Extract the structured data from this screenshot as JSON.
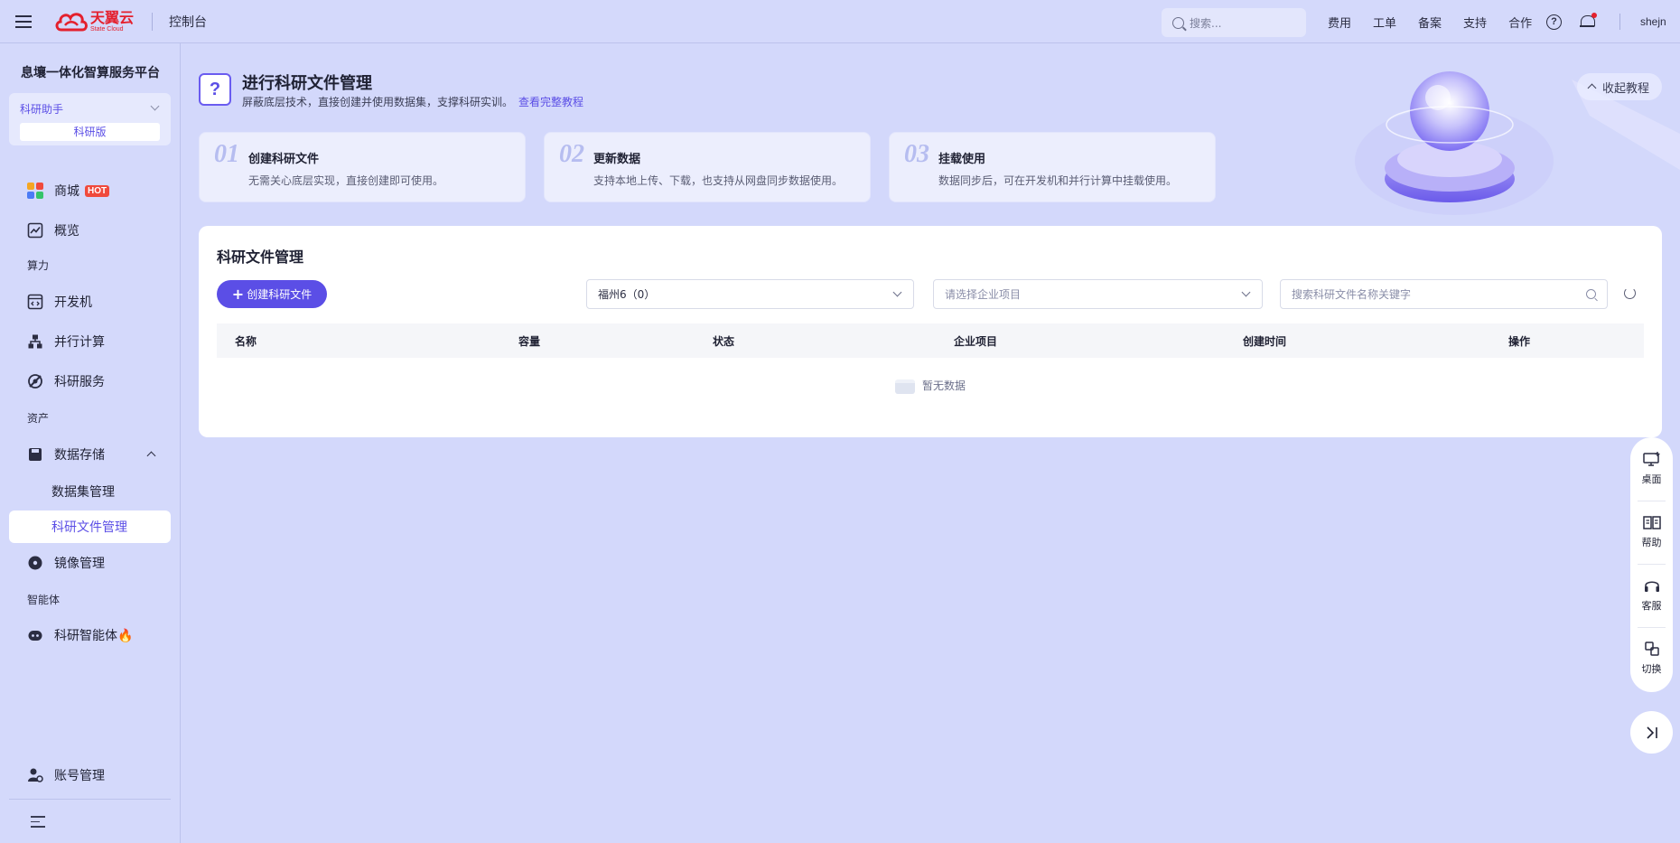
{
  "topbar": {
    "logo_cn": "天翼云",
    "logo_en": "State Cloud",
    "console": "控制台",
    "search_placeholder": "搜索...",
    "links": [
      "费用",
      "工单",
      "备案",
      "支持",
      "合作"
    ],
    "user": "shejn"
  },
  "sidebar": {
    "platform": "息壤一体化智算服务平台",
    "assistant": "科研助手",
    "edition": "科研版",
    "store": "商城",
    "hot": "HOT",
    "overview": "概览",
    "section_compute": "算力",
    "devbox": "开发机",
    "parallel": "并行计算",
    "research_service": "科研服务",
    "section_assets": "资产",
    "storage": "数据存储",
    "dataset_mgmt": "数据集管理",
    "file_mgmt": "科研文件管理",
    "image_mgmt": "镜像管理",
    "section_agent": "智能体",
    "agent": "科研智能体🔥",
    "account": "账号管理"
  },
  "intro": {
    "title": "进行科研文件管理",
    "desc": "屏蔽底层技术，直接创建并使用数据集，支撑科研实训。",
    "tutorial_link": "查看完整教程",
    "collapse": "收起教程",
    "steps": [
      {
        "num": "01",
        "title": "创建科研文件",
        "desc": "无需关心底层实现，直接创建即可使用。"
      },
      {
        "num": "02",
        "title": "更新数据",
        "desc": "支持本地上传、下载，也支持从网盘同步数据使用。"
      },
      {
        "num": "03",
        "title": "挂载使用",
        "desc": "数据同步后，可在开发机和并行计算中挂载使用。"
      }
    ]
  },
  "panel": {
    "title": "科研文件管理",
    "create_btn": "创建科研文件",
    "region": "福州6（0）",
    "project_placeholder": "请选择企业项目",
    "search_placeholder": "搜索科研文件名称关键字",
    "columns": [
      "名称",
      "容量",
      "状态",
      "企业项目",
      "创建时间",
      "操作"
    ],
    "empty": "暂无数据"
  },
  "float": {
    "desktop": "桌面",
    "help": "帮助",
    "service": "客服",
    "switch": "切换"
  }
}
